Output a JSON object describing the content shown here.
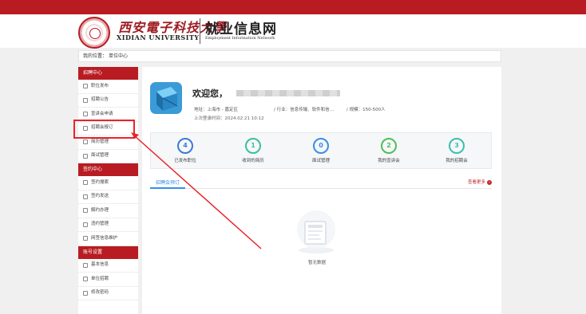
{
  "topbar": {
    "left_text": "",
    "right_text": ""
  },
  "header": {
    "university_cn": "西安電子科技大學",
    "university_en": "XIDIAN UNIVERSITY",
    "site_cn": "就业信息网",
    "site_en": "Employment Information Network"
  },
  "breadcrumb": {
    "label": "我的位置：",
    "current": "单位中心"
  },
  "sidebar": {
    "sections": [
      {
        "title": "招聘中心",
        "items": [
          "职位发布",
          "招聘公告",
          "宣讲会申请",
          "招聘会报订",
          "简历管理",
          "面试管理"
        ]
      },
      {
        "title": "签约中心",
        "items": [
          "签约搜索",
          "签约发送",
          "解约办理",
          "违约管理",
          "网签信息维护"
        ]
      },
      {
        "title": "账号设置",
        "items": [
          "基本信息",
          "单位招聘",
          "修改密码"
        ]
      }
    ]
  },
  "profile": {
    "welcome": "欢迎您，",
    "address_label": "地址：",
    "address": "上海市 - 嘉定区",
    "industry_label": "/ 行业：",
    "industry": "信息传输、软件和信…",
    "scale_label": "/ 规模：",
    "scale": "150-500人",
    "last_login_label": "上次登录时间：",
    "last_login": "2024.02.21 10:12"
  },
  "stats": [
    {
      "value": "4",
      "label": "已发布职位",
      "color": "#3a7bd5"
    },
    {
      "value": "1",
      "label": "收到的简历",
      "color": "#3bbf9a"
    },
    {
      "value": "0",
      "label": "面试管理",
      "color": "#3a8ee6"
    },
    {
      "value": "2",
      "label": "我的宣讲会",
      "color": "#4cbf5a"
    },
    {
      "value": "3",
      "label": "我的招聘会",
      "color": "#3bbfb0"
    }
  ],
  "tabs": {
    "active": "招聘会预订",
    "more": "查看更多"
  },
  "empty": {
    "text": "暂无数据"
  },
  "colors": {
    "brand_red": "#b81c22",
    "highlight_red": "#e8232a",
    "accent_blue": "#3a8ee6"
  }
}
